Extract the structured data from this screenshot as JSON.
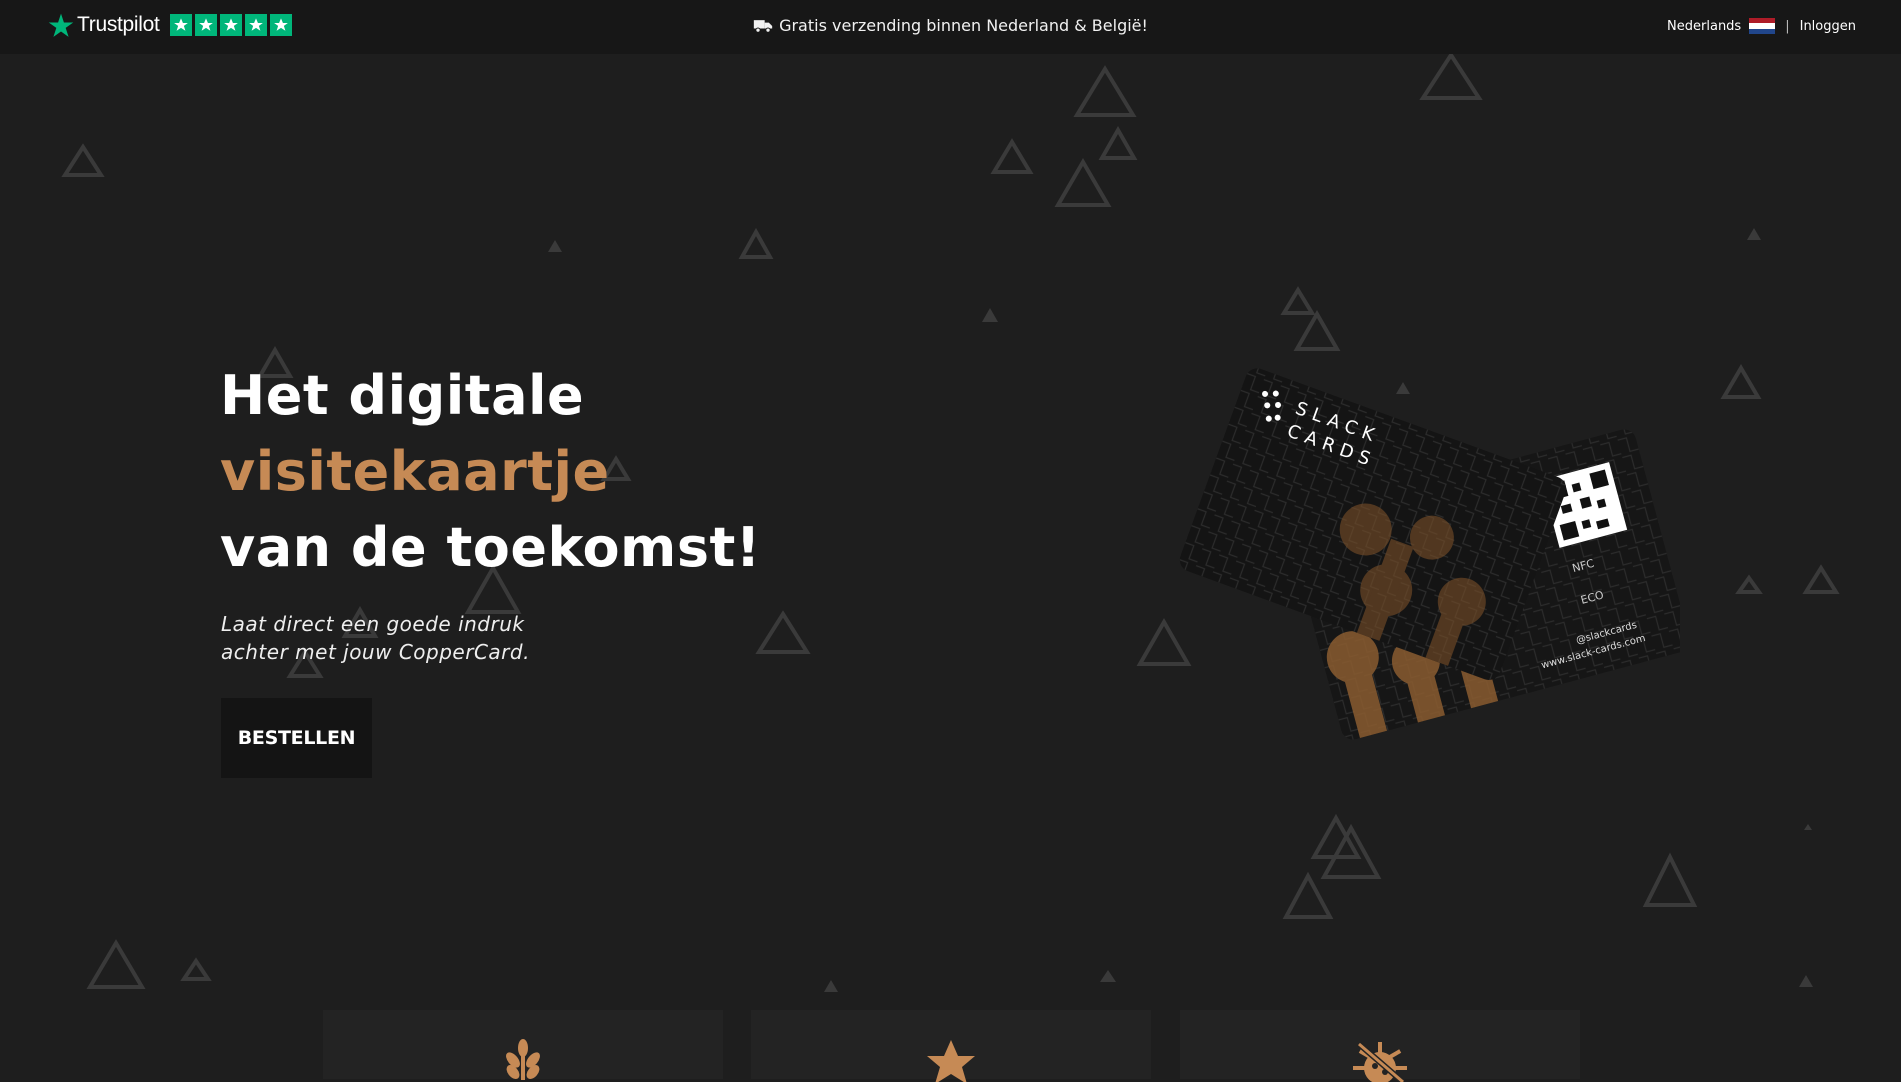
{
  "topbar": {
    "brand": "Trustpilot",
    "rating_stars": 5,
    "shipping_text": "Gratis verzending binnen Nederland & België!",
    "language": "Nederlands",
    "separator": "|",
    "login": "Inloggen"
  },
  "hero": {
    "title_line1": "Het digitale",
    "title_line2": "visitekaartje",
    "title_line3": "van de toekomst!",
    "subtitle_line1": "Laat direct een goede indruk",
    "subtitle_line2": "achter met jouw CopperCard.",
    "cta_label": "BESTELLEN"
  },
  "product_card": {
    "brand_top": "SLACK",
    "brand_bottom": "CARDS",
    "nfc_label": "NFC",
    "eco_label": "ECO",
    "handle": "@slackcards",
    "website": "www.slack-cards.com"
  },
  "features": [
    {
      "icon": "wheat-icon"
    },
    {
      "icon": "star-icon"
    },
    {
      "icon": "virus-slash-icon"
    }
  ],
  "colors": {
    "accent": "#c68a55",
    "background": "#1e1e1e",
    "topbar": "#171717",
    "trustpilot_green": "#00b67a"
  }
}
